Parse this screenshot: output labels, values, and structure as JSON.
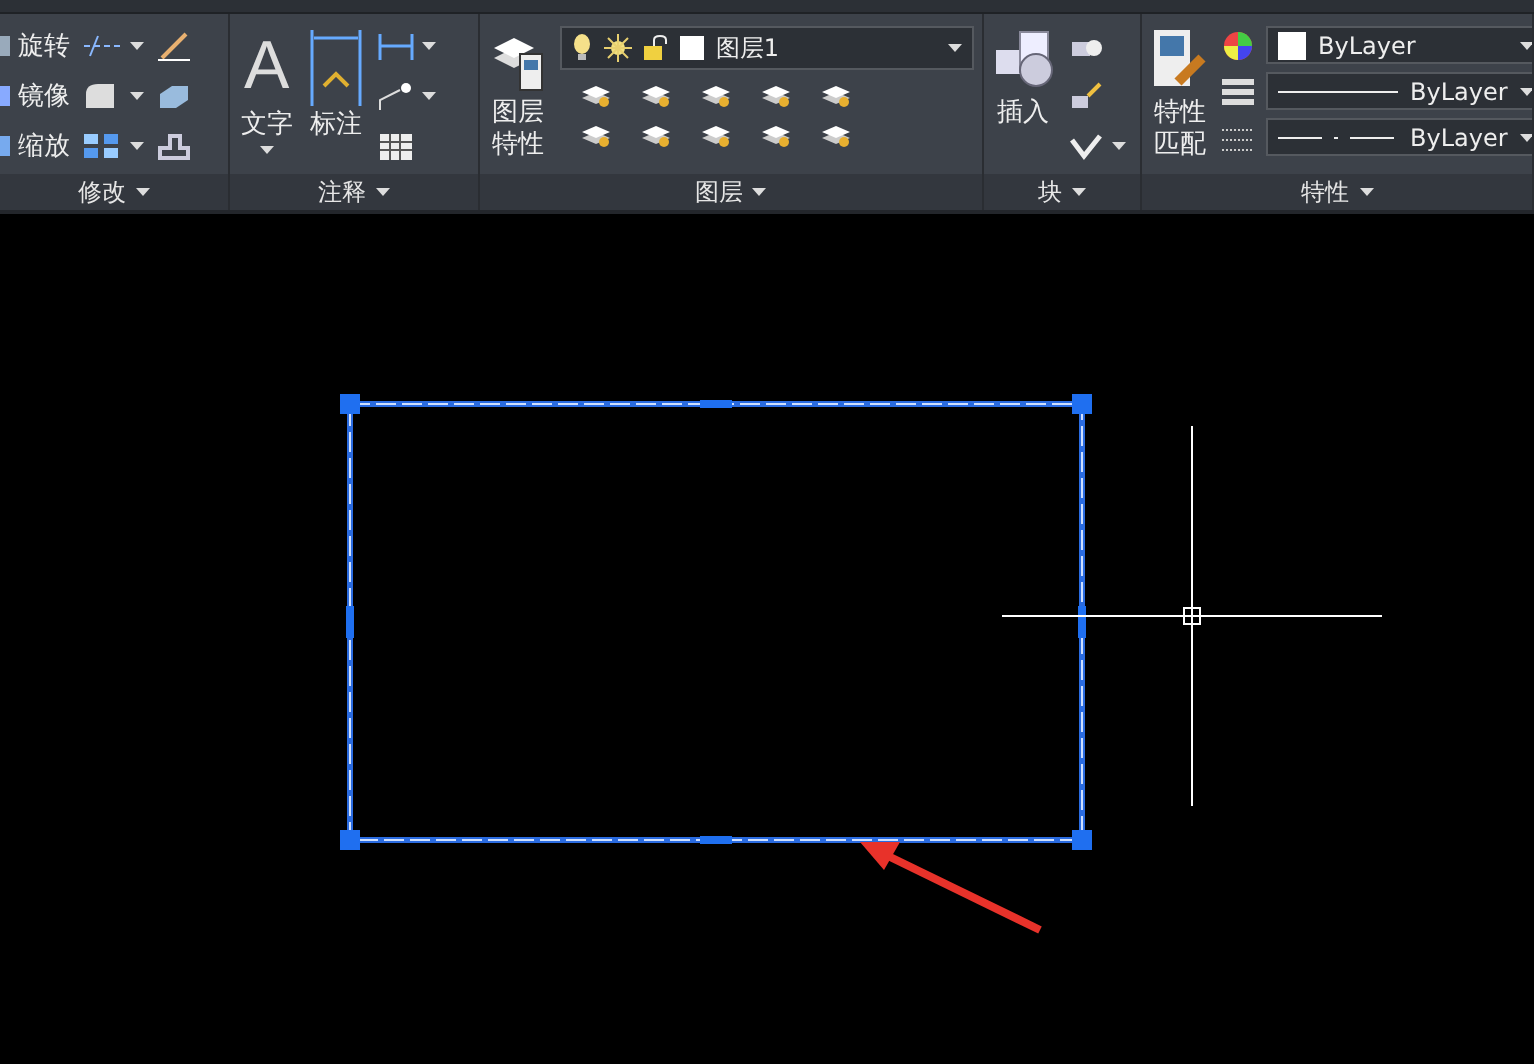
{
  "ribbon": {
    "panels": [
      {
        "kind": "modify",
        "title": "修改",
        "tools": [
          {
            "label": "旋转"
          },
          {
            "label": "镜像"
          },
          {
            "label": "缩放"
          }
        ]
      },
      {
        "kind": "annotation",
        "title": "注释",
        "tools": [
          {
            "label": "文字",
            "glyph": "A",
            "dropdown": true
          },
          {
            "label": "标注",
            "dropdown": false
          }
        ]
      },
      {
        "kind": "layers",
        "title": "图层",
        "tools": [
          {
            "label": "图层特性"
          }
        ],
        "layer_dropdown": {
          "value": "图层1"
        }
      },
      {
        "kind": "block",
        "title": "块",
        "tools": [
          {
            "label": "插入"
          }
        ]
      },
      {
        "kind": "properties",
        "title": "特性",
        "tools": [
          {
            "label": "特性匹配"
          }
        ],
        "dropdowns": [
          {
            "kind": "color",
            "value": "ByLayer"
          },
          {
            "kind": "lineweight",
            "value": "ByLayer"
          },
          {
            "kind": "linetype",
            "value": "ByLayer"
          }
        ]
      }
    ]
  },
  "canvas": {
    "rectangle": {
      "selected": true
    }
  }
}
